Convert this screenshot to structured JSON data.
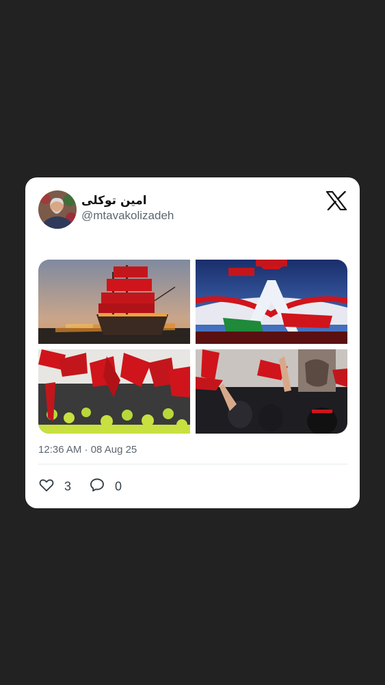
{
  "tweet": {
    "display_name": "امین توکلی",
    "handle": "@mtavakolizadeh",
    "timestamp": "12:36 AM · 08 Aug 25",
    "likes": "3",
    "replies": "0"
  },
  "icons": {
    "brand": "x-logo-icon",
    "like": "heart-outline-icon",
    "reply": "speech-bubble-icon"
  },
  "media": [
    {
      "subject": "ship-with-red-banners"
    },
    {
      "subject": "azadi-tower-with-flags"
    },
    {
      "subject": "crowd-with-red-flags"
    },
    {
      "subject": "mourners-raising-flags"
    }
  ],
  "colors": {
    "background": "#222222",
    "card": "#ffffff",
    "secondary_text": "#5b6670",
    "flag_red": "#d0141b"
  }
}
